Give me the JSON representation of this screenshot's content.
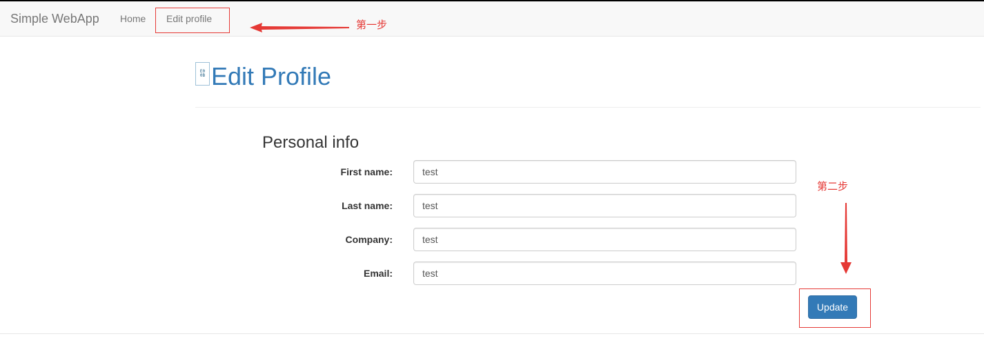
{
  "navbar": {
    "brand": "Simple WebApp",
    "items": [
      {
        "label": "Home"
      },
      {
        "label": "Edit profile"
      }
    ]
  },
  "header": {
    "avatar_alt": "E0\n0B",
    "title": "Edit Profile"
  },
  "form": {
    "section_title": "Personal info",
    "fields": [
      {
        "label": "First name:",
        "value": "test"
      },
      {
        "label": "Last name:",
        "value": "test"
      },
      {
        "label": "Company:",
        "value": "test"
      },
      {
        "label": "Email:",
        "value": "test"
      }
    ],
    "submit_label": "Update"
  },
  "annotations": {
    "step1": "第一步",
    "step2": "第二步",
    "color": "#e53935"
  },
  "colors": {
    "primary": "#337ab7",
    "navbar_bg": "#f8f8f8",
    "annotation": "#e53935"
  }
}
